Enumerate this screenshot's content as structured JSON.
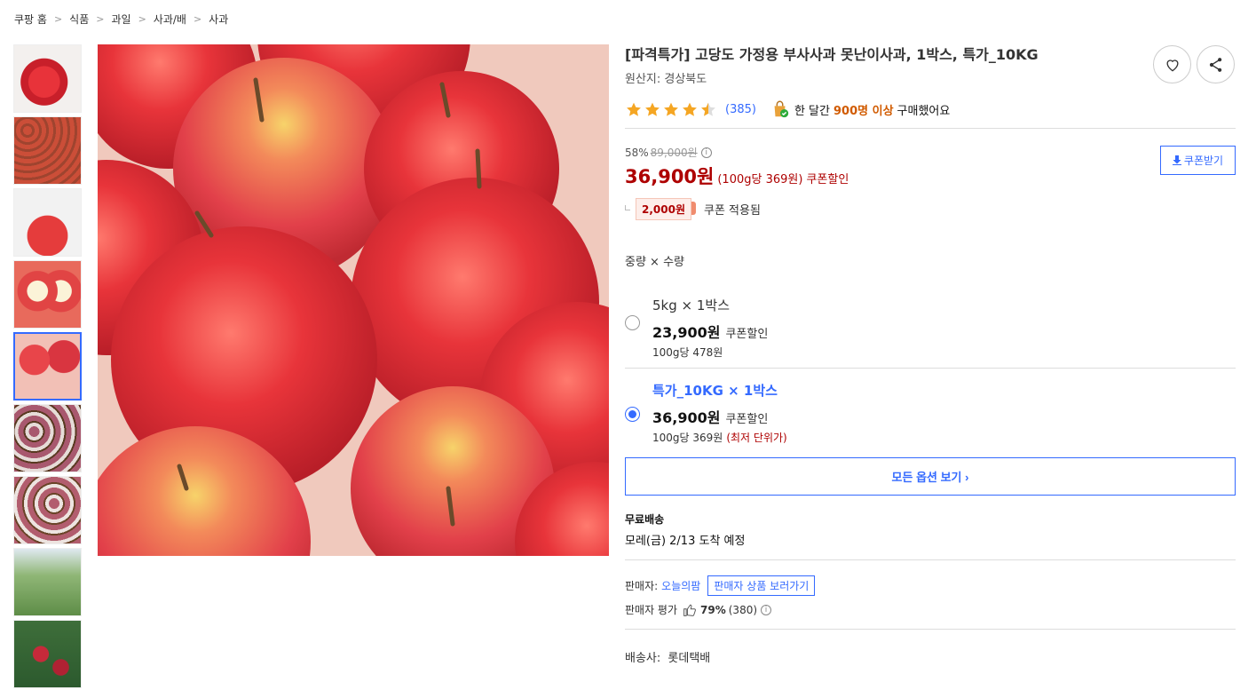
{
  "breadcrumb": [
    "쿠팡 홈",
    "식품",
    "과일",
    "사과/배",
    "사과"
  ],
  "product": {
    "title": "[파격특가] 고당도 가정용 부사사과 못난이사과, 1박스, 특가_10KG",
    "origin": "원산지: 경상북도",
    "rating": 4.5,
    "review_count": "(385)",
    "buy_info_pre": "한 달간",
    "buy_info_hl": "900명 이상",
    "buy_info_post": "구매했어요"
  },
  "pricing": {
    "discount_rate": "58%",
    "original_price": "89,000원",
    "info_icon": "i",
    "sale_price": "36,900원",
    "unit_price": "(100g당 369원)",
    "coupon_label": "쿠폰할인",
    "coupon_amount": "2,000원",
    "coupon_applied": "쿠폰 적용됨",
    "coupon_button": "쿠폰받기"
  },
  "options": {
    "title": "중량 × 수량",
    "items": [
      {
        "name": "5kg × 1박스",
        "price": "23,900원",
        "coupon": "쿠폰할인",
        "unit": "100g당 478원",
        "badge": "",
        "selected": false
      },
      {
        "name": "특가_10KG × 1박스",
        "price": "36,900원",
        "coupon": "쿠폰할인",
        "unit": "100g당 369원",
        "badge": "(최저 단위가)",
        "selected": true
      }
    ],
    "all_options_label": "모든 옵션 보기 ›"
  },
  "shipping": {
    "label": "무료배송",
    "arrival": "모레(금) 2/13 도착 예정"
  },
  "seller": {
    "label": "판매자:",
    "name": "오늘의팜",
    "products_link": "판매자 상품 보러가기",
    "rating_label": "판매자 평가",
    "rating_pct": "79%",
    "rating_count": "(380)"
  },
  "courier": {
    "label": "배송사:",
    "name": "롯데택배"
  },
  "colors": {
    "accent": "#346aff",
    "price_red": "#ae0000",
    "star": "#f5a623",
    "highlight_orange": "#d15b00"
  }
}
